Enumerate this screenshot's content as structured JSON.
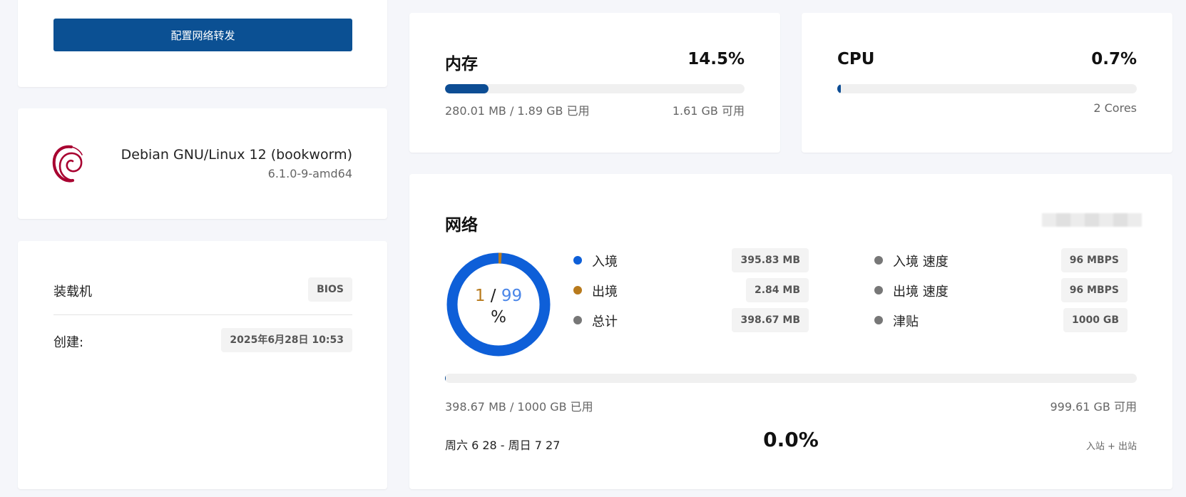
{
  "forward_card": {
    "button_label": "配置网络转发"
  },
  "os_card": {
    "logo_icon": "debian-swirl-icon",
    "name": "Debian GNU/Linux 12 (bookworm)",
    "kernel": "6.1.0-9-amd64"
  },
  "info_card": {
    "boot_label": "装载机",
    "boot_value": "BIOS",
    "created_label": "创建:",
    "created_value": "2025年6月28日 10:53"
  },
  "memory": {
    "title": "内存",
    "percent_text": "14.5%",
    "used_fraction": 0.145,
    "used_text": "280.01 MB / 1.89 GB 已用",
    "available_text": "1.61 GB 可用"
  },
  "cpu": {
    "title": "CPU",
    "percent_text": "0.7%",
    "used_fraction": 0.007,
    "cores_text": "2 Cores"
  },
  "network": {
    "title": "网络",
    "donut": {
      "outbound_share": 1,
      "inbound_share": 99,
      "separator": "/",
      "unit": "%",
      "colors": {
        "inbound": "#0e5fd8",
        "outbound": "#b87a1c"
      }
    },
    "legend_left": [
      {
        "label": "入境",
        "value": "395.83 MB",
        "color": "#0e5fd8"
      },
      {
        "label": "出境",
        "value": "2.84 MB",
        "color": "#b87a1c"
      },
      {
        "label": "总计",
        "value": "398.67 MB",
        "color": "#777777"
      }
    ],
    "legend_right": [
      {
        "label": "入境 速度",
        "value": "96 MBPS",
        "color": "#777777"
      },
      {
        "label": "出境 速度",
        "value": "96 MBPS",
        "color": "#777777"
      },
      {
        "label": "津贴",
        "value": "1000 GB",
        "color": "#777777"
      }
    ],
    "usage_fraction": 0.0004,
    "used_text": "398.67 MB / 1000 GB 已用",
    "available_text": "999.61 GB 可用",
    "period": "周六 6 28 - 周日 7 27",
    "period_percent": "0.0%",
    "in_out_label": "入站 + 出站"
  }
}
